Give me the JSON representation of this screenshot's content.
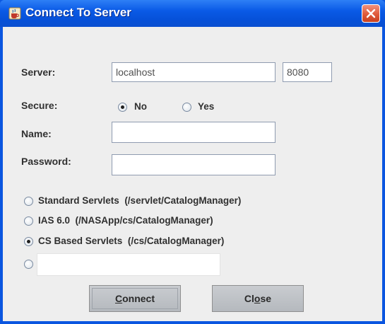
{
  "window": {
    "title": "Connect To Server"
  },
  "form": {
    "server_label": "Server:",
    "server_value": "localhost",
    "port_value": "8080",
    "secure_label": "Secure:",
    "secure_no": "No",
    "secure_yes": "Yes",
    "secure_selected": "No",
    "name_label": "Name:",
    "name_value": "",
    "password_label": "Password:",
    "password_value": ""
  },
  "paths": {
    "selected": "CS Based Servlets",
    "options": [
      {
        "name": "Standard Servlets",
        "path": "(/servlet/CatalogManager)"
      },
      {
        "name": "IAS 6.0",
        "path": "(/NASApp/cs/CatalogManager)"
      },
      {
        "name": "CS Based Servlets",
        "path": "(/cs/CatalogManager)"
      }
    ],
    "custom_value": ""
  },
  "buttons": {
    "connect_mnemonic": "C",
    "connect_rest": "onnect",
    "close_prefix": "Cl",
    "close_mnemonic": "o",
    "close_rest": "se"
  },
  "icons": {
    "app": "java-cup-icon",
    "close": "close-x-icon"
  },
  "colors": {
    "titlebar": "#0a5ae6",
    "close_button": "#e05a3a",
    "client_bg": "#eeeeee"
  }
}
